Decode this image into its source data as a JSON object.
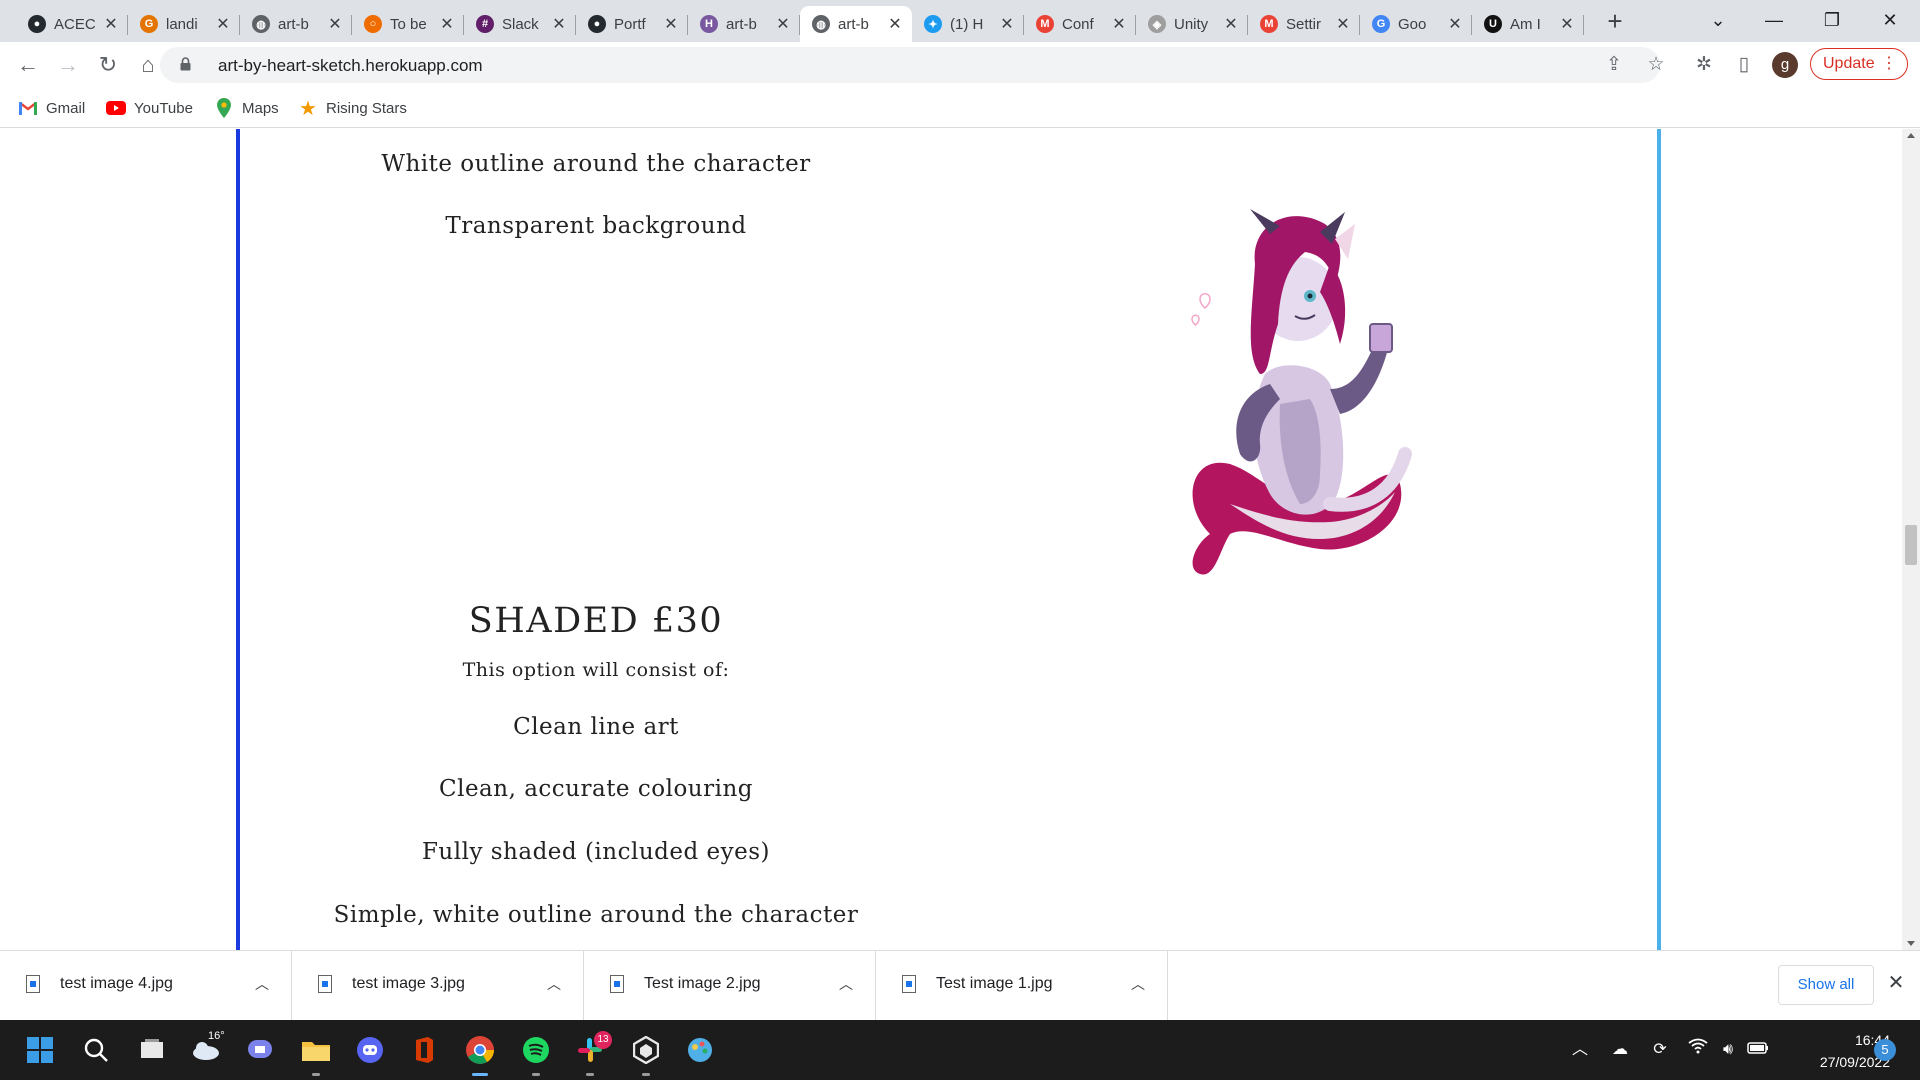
{
  "browser": {
    "tabs": [
      {
        "title": "ACEC",
        "favicon": "github-icon",
        "active": false
      },
      {
        "title": "landi",
        "favicon": "grammarly-icon",
        "active": false
      },
      {
        "title": "art-b",
        "favicon": "globe-icon",
        "active": false
      },
      {
        "title": "To be",
        "favicon": "todo-ring-icon",
        "active": false
      },
      {
        "title": "Slack",
        "favicon": "slack-icon",
        "active": false
      },
      {
        "title": "Portf",
        "favicon": "github-icon",
        "active": false
      },
      {
        "title": "art-b",
        "favicon": "heroku-icon",
        "active": false
      },
      {
        "title": "art-b",
        "favicon": "globe-icon",
        "active": true
      },
      {
        "title": "(1) H",
        "favicon": "twitter-icon",
        "active": false
      },
      {
        "title": "Conf",
        "favicon": "gmail-icon",
        "active": false
      },
      {
        "title": "Unity",
        "favicon": "unity-icon",
        "active": false
      },
      {
        "title": "Settir",
        "favicon": "gmail-icon",
        "active": false
      },
      {
        "title": "Goo",
        "favicon": "google-icon",
        "active": false
      },
      {
        "title": "Am I",
        "favicon": "udemy-icon",
        "active": false
      }
    ],
    "url": "art-by-heart-sketch.herokuapp.com",
    "update_label": "Update",
    "profile_initial": "g",
    "bookmarks": [
      {
        "label": "Gmail",
        "icon": "gmail-icon"
      },
      {
        "label": "YouTube",
        "icon": "youtube-icon"
      },
      {
        "label": "Maps",
        "icon": "maps-icon"
      },
      {
        "label": "Rising Stars",
        "icon": "star-icon"
      }
    ]
  },
  "page": {
    "lines_top": [
      "White outline around the character",
      "Transparent background"
    ],
    "shaded": {
      "heading": "SHADED £30",
      "subheading": "This option will consist of:",
      "items": [
        "Clean line art",
        "Clean, accurate colouring",
        "Fully shaded (included eyes)",
        "Simple, white outline around the character"
      ]
    },
    "image_alt": "character-artwork",
    "colors": {
      "left_border": "#1a3be0",
      "right_border": "#4cb1e9"
    }
  },
  "downloads": {
    "items": [
      {
        "name": "test image 4.jpg"
      },
      {
        "name": "test image 3.jpg"
      },
      {
        "name": "Test image 2.jpg"
      },
      {
        "name": "Test image 1.jpg"
      }
    ],
    "show_all_label": "Show all"
  },
  "taskbar": {
    "weather_temp": "16°",
    "slack_badge": "13",
    "time": "16:44",
    "date": "27/09/2022",
    "notification_count": "5"
  }
}
